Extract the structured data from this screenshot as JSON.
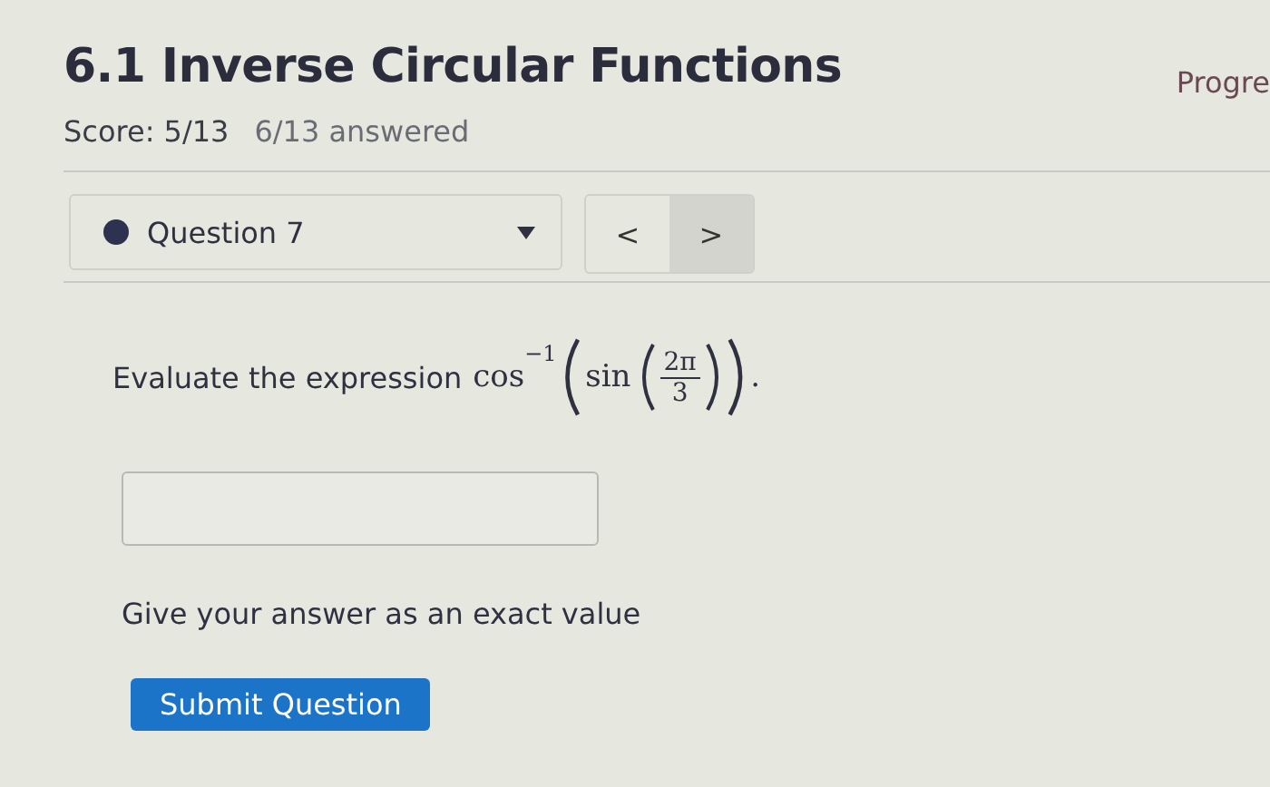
{
  "header": {
    "title": "6.1 Inverse Circular Functions",
    "score": "Score: 5/13",
    "answered": "6/13 answered",
    "progress": "Progre"
  },
  "question_nav": {
    "label": "Question 7",
    "prev": "<",
    "next": ">"
  },
  "question": {
    "prompt": "Evaluate the expression",
    "func": "cos",
    "exponent": "−1",
    "inner_func": "sin",
    "numerator": "2π",
    "denominator": "3",
    "end": "."
  },
  "hint": "Give your answer as an exact value",
  "submit": "Submit Question"
}
